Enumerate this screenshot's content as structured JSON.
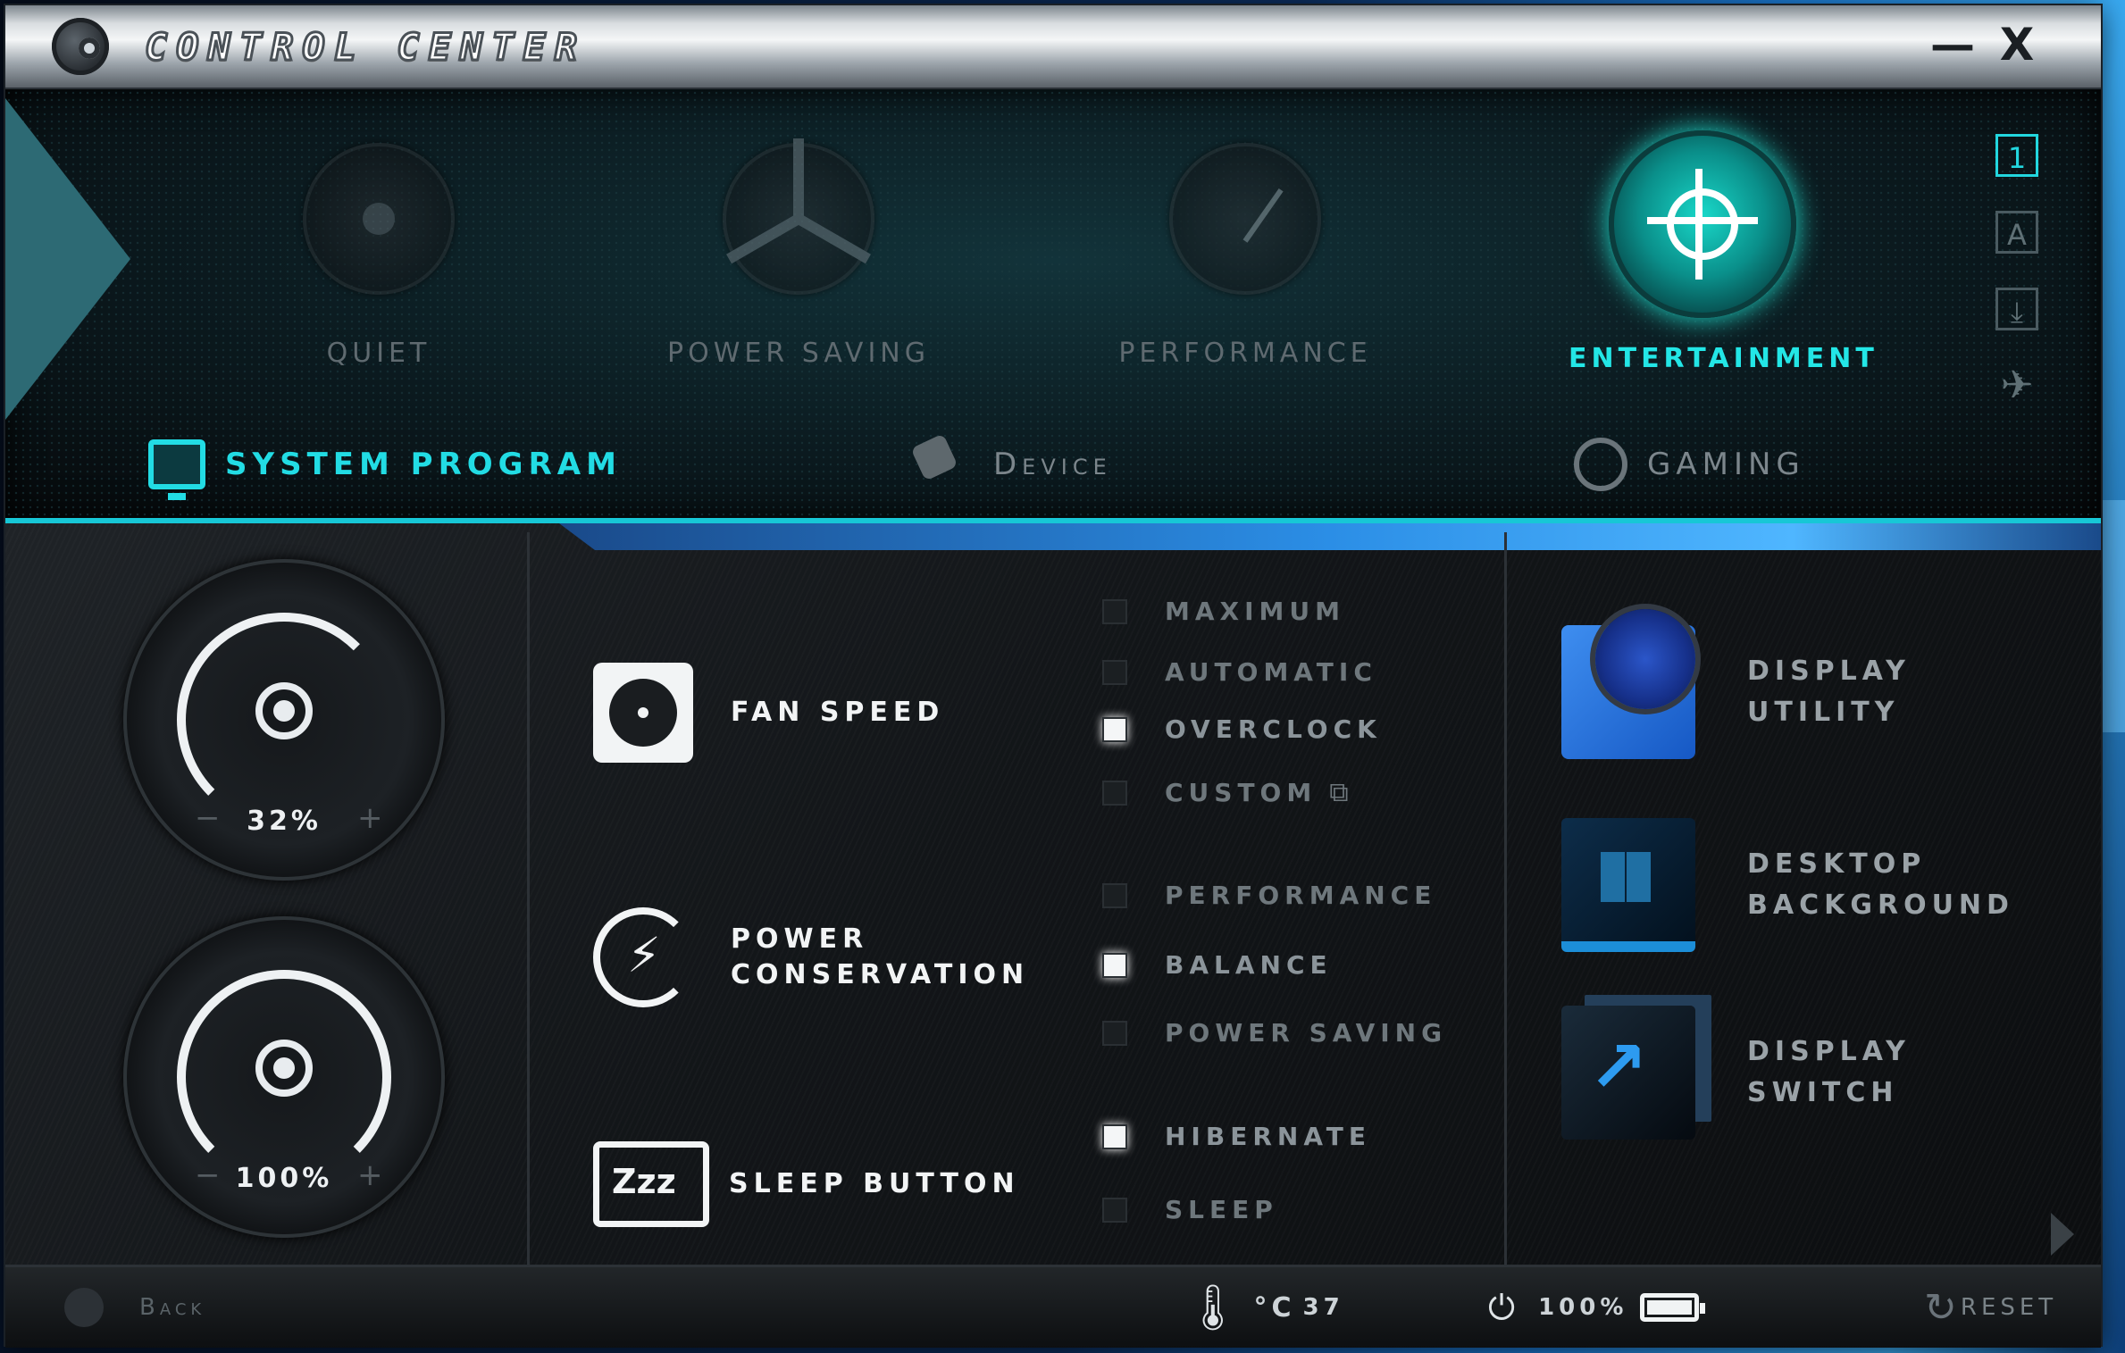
{
  "window": {
    "title": "CONTROL CENTER",
    "minimize_label": "—",
    "close_label": "X"
  },
  "modes": [
    {
      "label": "QUIET",
      "icon": "speaker-icon",
      "active": false
    },
    {
      "label": "POWER SAVING",
      "icon": "fan-icon",
      "active": false
    },
    {
      "label": "PERFORMANCE",
      "icon": "gauge-icon",
      "active": false
    },
    {
      "label": "ENTERTAINMENT",
      "icon": "crosshair-icon",
      "active": true
    }
  ],
  "side_icons": [
    {
      "label": "1",
      "icon": "profile-1-icon",
      "active": true
    },
    {
      "label": "A",
      "icon": "profile-a-icon",
      "active": false
    },
    {
      "label": "⤓",
      "icon": "download-icon",
      "active": false
    },
    {
      "label": "✈",
      "icon": "airplane-mode-icon",
      "active": false
    }
  ],
  "nav_tabs": [
    {
      "label": "SYSTEM PROGRAM",
      "icon": "monitor-icon",
      "active": true
    },
    {
      "label": "Device",
      "icon": "plug-icon",
      "active": false
    },
    {
      "label": "GAMING",
      "icon": "steering-wheel-icon",
      "active": false
    }
  ],
  "knobs": {
    "fan": {
      "value": "32%",
      "minus": "−",
      "plus": "+",
      "icon": "fan-control-icon"
    },
    "brightness": {
      "value": "100%",
      "minus": "−",
      "plus": "+",
      "icon": "brightness-icon"
    }
  },
  "features": {
    "fan_speed": {
      "label": "FAN SPEED"
    },
    "power_conservation": {
      "label_line1": "POWER",
      "label_line2": "CONSERVATION"
    },
    "sleep_button": {
      "label": "SLEEP BUTTON",
      "icon_text": "Zzz"
    }
  },
  "options": {
    "fan": [
      {
        "label": "MAXIMUM",
        "checked": false
      },
      {
        "label": "AUTOMATIC",
        "checked": false
      },
      {
        "label": "OVERCLOCK",
        "checked": true
      },
      {
        "label": "CUSTOM",
        "checked": false
      }
    ],
    "power": [
      {
        "label": "PERFORMANCE",
        "checked": false
      },
      {
        "label": "BALANCE",
        "checked": true
      },
      {
        "label": "POWER SAVING",
        "checked": false
      }
    ],
    "sleep": [
      {
        "label": "HIBERNATE",
        "checked": true
      },
      {
        "label": "SLEEP",
        "checked": false
      }
    ]
  },
  "utilities": [
    {
      "line1": "DISPLAY",
      "line2": "UTILITY",
      "icon": "display-utility-icon"
    },
    {
      "line1": "DESKTOP",
      "line2": "BACKGROUND",
      "icon": "desktop-background-icon"
    },
    {
      "line1": "DISPLAY",
      "line2": "SWITCH",
      "icon": "display-switch-icon"
    }
  ],
  "footer": {
    "back_label": "Back",
    "temp_unit": "°C",
    "temperature": "37",
    "battery_percent": "100%",
    "reset_label": "RESET"
  },
  "colors": {
    "accent": "#22dce4",
    "active_mode": "#23e6e6",
    "checkbox_on": "#f4f6f7"
  }
}
